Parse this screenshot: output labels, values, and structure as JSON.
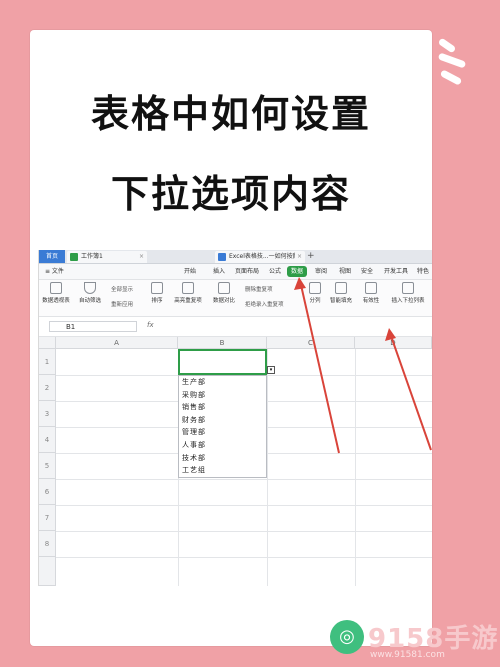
{
  "title": {
    "line1": "表格中如何设置",
    "line2": "下拉选项内容"
  },
  "tabbar": {
    "home": "首页",
    "tab1": "工作簿1",
    "tab2": "Excel表格技...一如何按颜色筛选",
    "plus": "+"
  },
  "menu": {
    "items": [
      "≡ 文件",
      "开始",
      "插入",
      "页面布局",
      "公式",
      "数据",
      "审阅",
      "视图",
      "安全",
      "开发工具",
      "特色"
    ],
    "active": "数据"
  },
  "ribbon": {
    "buttons": [
      "数据透视表",
      "自动筛选",
      "全部显示",
      "重新应用",
      "排序",
      "高亮重复项",
      "数据对比",
      "删除重复项",
      "拒绝录入重复项",
      "分列",
      "智能填充",
      "有效性",
      "插入下拉列表"
    ]
  },
  "formula_bar": {
    "name_box": "B1",
    "fx": "fx"
  },
  "grid": {
    "columns": [
      "A",
      "B",
      "C",
      "D"
    ],
    "rows": [
      "1",
      "2",
      "3",
      "4",
      "5",
      "6",
      "7",
      "8"
    ]
  },
  "dropdown": {
    "options": [
      "生产部",
      "采购部",
      "销售部",
      "财务部",
      "管理部",
      "人事部",
      "技术部",
      "工艺组"
    ]
  },
  "watermark": {
    "brand": "9158手游",
    "url": "www.91581.com"
  },
  "colors": {
    "background": "#f0a1a6",
    "accent_green": "#2e9d48",
    "arrow_red": "#d9443a"
  }
}
